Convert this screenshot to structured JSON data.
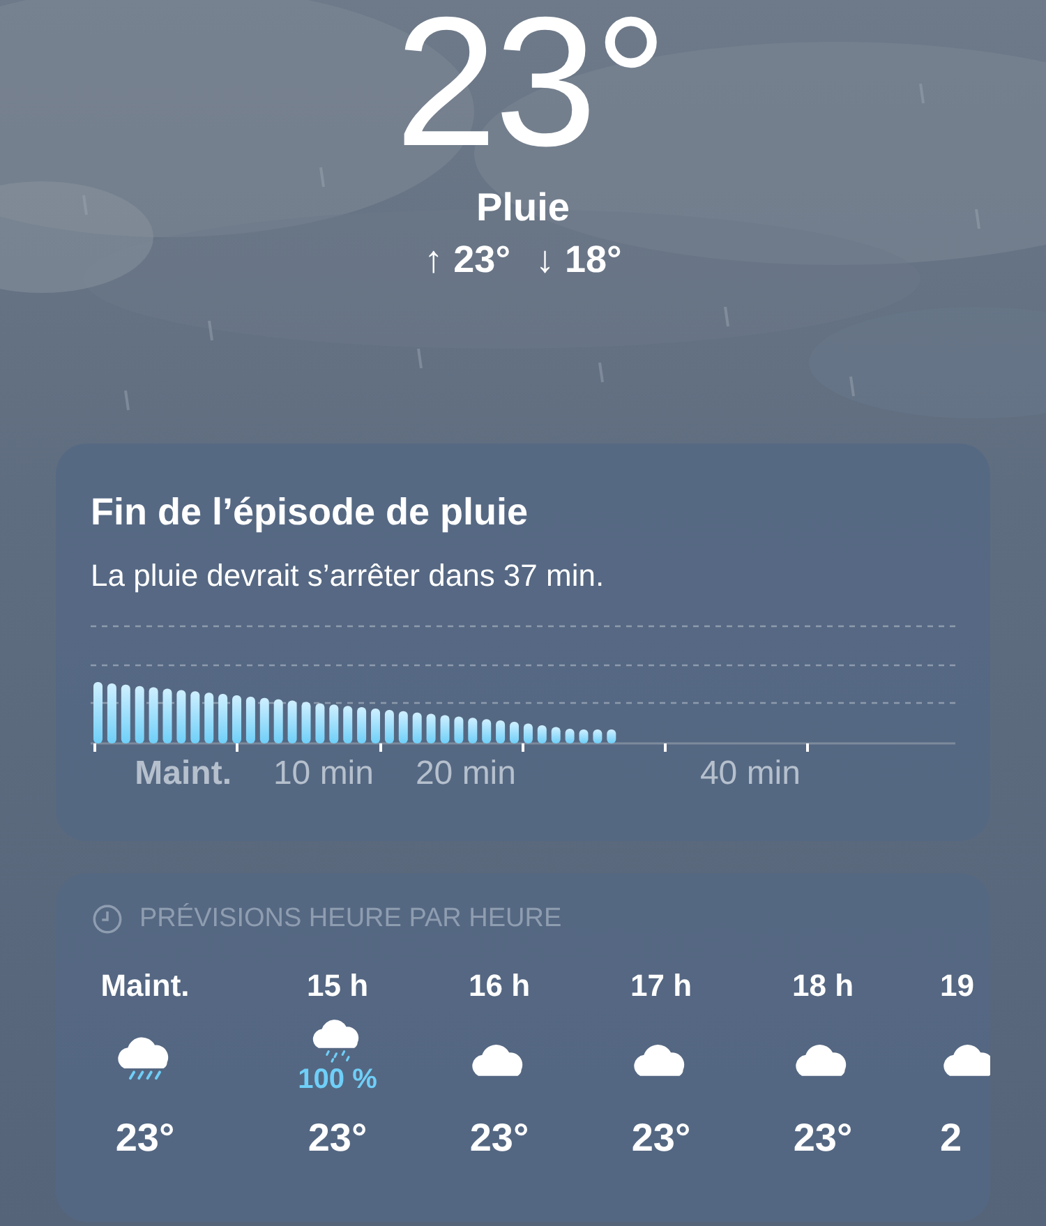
{
  "current": {
    "temperature": "23°",
    "condition": "Pluie",
    "high": "↑ 23°",
    "low": "↓ 18°"
  },
  "rain_card": {
    "title": "Fin de l’épisode de pluie",
    "message": "La pluie devrait s’arrêter dans 37 min.",
    "axis_labels": [
      {
        "text": "Maint.",
        "bold": true
      },
      {
        "text": "10 min",
        "bold": false
      },
      {
        "text": "20 min",
        "bold": false
      },
      {
        "text": "40 min",
        "bold": false
      }
    ]
  },
  "hourly": {
    "header": "PRÉVISIONS HEURE PAR HEURE",
    "hours": [
      {
        "time": "Maint.",
        "kind": "rain",
        "temp": "23°"
      },
      {
        "time": "15 h",
        "kind": "rain-small",
        "precip": "100 %",
        "temp": "23°"
      },
      {
        "time": "16 h",
        "kind": "cloud",
        "temp": "23°"
      },
      {
        "time": "17 h",
        "kind": "cloud",
        "temp": "23°"
      },
      {
        "time": "18 h",
        "kind": "cloud",
        "temp": "23°"
      },
      {
        "time": "19",
        "kind": "cloud",
        "temp": "2"
      }
    ]
  }
}
